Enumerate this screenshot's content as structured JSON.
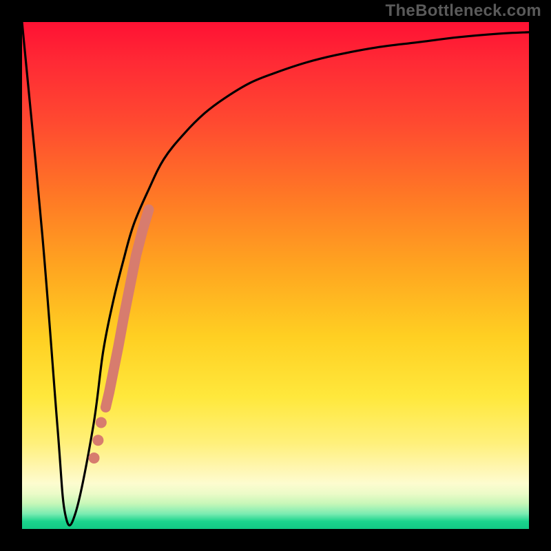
{
  "attribution": "TheBottleneck.com",
  "chart_data": {
    "type": "line",
    "title": "",
    "xlabel": "",
    "ylabel": "",
    "xlim": [
      0,
      100
    ],
    "ylim": [
      0,
      100
    ],
    "background_gradient": {
      "top": "#ff1133",
      "mid_upper": "#ff7a25",
      "mid": "#ffe83c",
      "mid_lower": "#fff6b0",
      "bottom": "#12c884"
    },
    "series": [
      {
        "name": "bottleneck-curve",
        "color": "#000000",
        "x": [
          0,
          4,
          7,
          8.5,
          10.5,
          14,
          16,
          18,
          20,
          22,
          25,
          28,
          32,
          36,
          40,
          45,
          50,
          56,
          62,
          70,
          78,
          86,
          94,
          100
        ],
        "values": [
          100,
          58,
          20,
          3,
          3,
          20,
          35,
          45,
          53,
          60,
          67,
          73,
          78,
          82,
          85,
          88,
          90,
          92,
          93.5,
          95,
          96,
          97,
          97.7,
          98
        ]
      },
      {
        "name": "highlight-segment",
        "color": "#d77c6e",
        "type": "scatter",
        "x": [
          16.5,
          17.2,
          18.0,
          19.0,
          20.1,
          21.3,
          22.5,
          23.8,
          25.0
        ],
        "values": [
          24,
          27,
          31,
          36,
          42,
          48,
          54,
          59,
          63
        ]
      },
      {
        "name": "highlight-dots",
        "color": "#d77c6e",
        "type": "scatter",
        "x": [
          15.6,
          15.0,
          14.2
        ],
        "values": [
          21.0,
          17.5,
          14.0
        ]
      }
    ]
  }
}
